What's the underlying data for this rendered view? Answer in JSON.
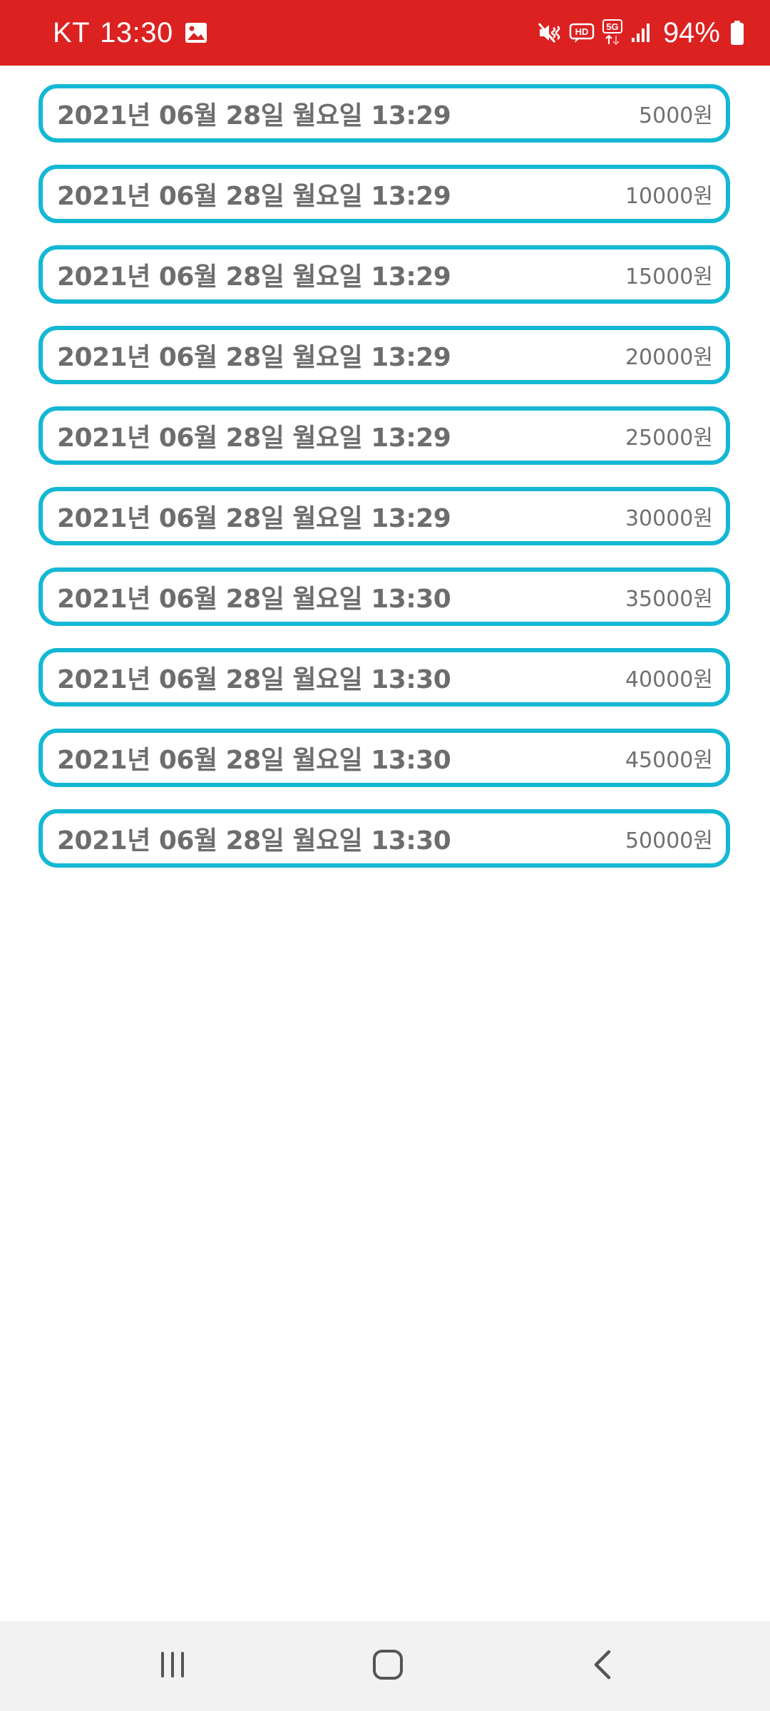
{
  "status_bar": {
    "carrier": "KT",
    "time": "13:30",
    "battery": "94%",
    "color": "#dc2121",
    "icons": [
      "image-icon",
      "mute-vibrate-icon",
      "hd-voice-icon",
      "5g-icon",
      "signal-icon",
      "battery-icon"
    ]
  },
  "entries": [
    {
      "date": "2021년 06월 28일 월요일 13:29",
      "amount": "5000원"
    },
    {
      "date": "2021년 06월 28일 월요일 13:29",
      "amount": "10000원"
    },
    {
      "date": "2021년 06월 28일 월요일 13:29",
      "amount": "15000원"
    },
    {
      "date": "2021년 06월 28일 월요일 13:29",
      "amount": "20000원"
    },
    {
      "date": "2021년 06월 28일 월요일 13:29",
      "amount": "25000원"
    },
    {
      "date": "2021년 06월 28일 월요일 13:29",
      "amount": "30000원"
    },
    {
      "date": "2021년 06월 28일 월요일 13:30",
      "amount": "35000원"
    },
    {
      "date": "2021년 06월 28일 월요일 13:30",
      "amount": "40000원"
    },
    {
      "date": "2021년 06월 28일 월요일 13:30",
      "amount": "45000원"
    },
    {
      "date": "2021년 06월 28일 월요일 13:30",
      "amount": "50000원"
    }
  ],
  "colors": {
    "item_border": "#14b8d4",
    "text": "#6d6d6d",
    "nav_background": "#f2f2f2"
  },
  "nav_bar": {
    "icons": [
      "recent-apps-icon",
      "home-icon",
      "back-icon"
    ]
  }
}
